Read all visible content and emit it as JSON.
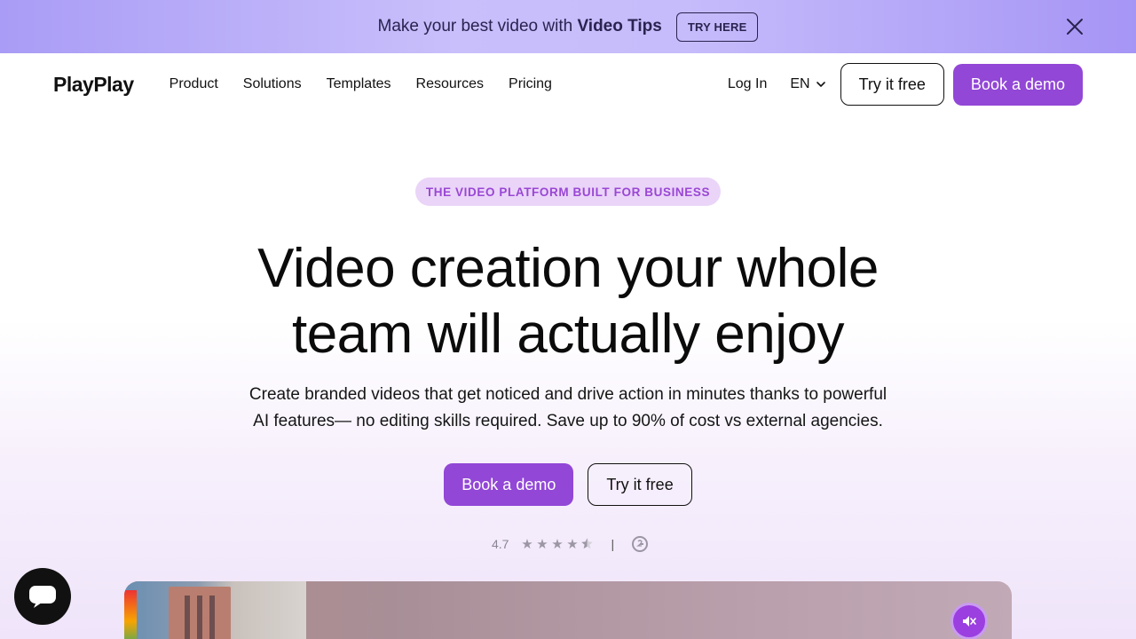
{
  "banner": {
    "text_prefix": "Make your best video with ",
    "text_bold": "Video Tips",
    "button_label": "TRY HERE"
  },
  "nav": {
    "logo": "PlayPlay",
    "links": [
      "Product",
      "Solutions",
      "Templates",
      "Resources",
      "Pricing"
    ],
    "login": "Log In",
    "language": "EN",
    "try_free": "Try it free",
    "book_demo": "Book a demo"
  },
  "hero": {
    "pill": "THE VIDEO PLATFORM BUILT FOR BUSINESS",
    "headline_line1": "Video creation your whole",
    "headline_line2": "team will actually enjoy",
    "subtext_line1": "Create branded videos that get noticed and drive action in minutes thanks to powerful",
    "subtext_line2": "AI features— no editing skills required. Save up to 90% of cost vs external agencies.",
    "cta_primary": "Book a demo",
    "cta_secondary": "Try it free",
    "rating": "4.7",
    "rating_separator": "|"
  },
  "colors": {
    "accent": "#9247d6",
    "pill_bg": "#ead4f8",
    "pill_text": "#9a47d4"
  },
  "icons": {
    "close": "close-icon",
    "chevron": "chevron-down-icon",
    "star": "star-icon",
    "g2": "g2-logo-icon",
    "mute": "speaker-muted-icon",
    "chat": "chat-bubble-icon"
  }
}
